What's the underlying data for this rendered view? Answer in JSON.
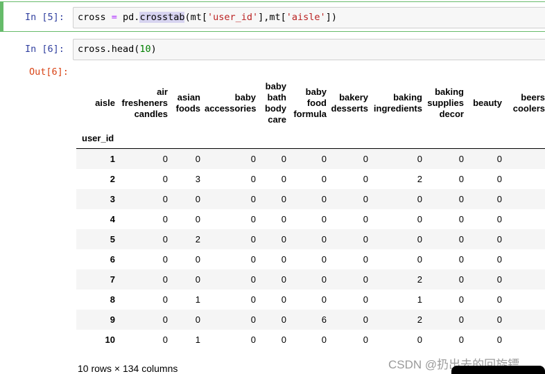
{
  "cells": [
    {
      "prompt": "In  [5]:",
      "code": {
        "a": "cross ",
        "op": "=",
        "b": " pd.",
        "hl": "crosstab",
        "c": "(mt[",
        "s1": "'user_id'",
        "d": "],mt[",
        "s2": "'aisle'",
        "e": "])"
      }
    },
    {
      "prompt": "In  [6]:",
      "code": {
        "a": "cross.head(",
        "n": "10",
        "e": ")"
      }
    }
  ],
  "output_prompt": "Out[6]:",
  "table": {
    "columns_label": "aisle",
    "index_label": "user_id",
    "columns": [
      "air fresheners candles",
      "asian foods",
      "baby accessories",
      "baby bath body care",
      "baby food formula",
      "bakery desserts",
      "baking ingredients",
      "baking supplies decor",
      "beauty",
      "beers coolers"
    ],
    "rows": [
      {
        "id": "1",
        "v": [
          "0",
          "0",
          "0",
          "0",
          "0",
          "0",
          "0",
          "0",
          "0"
        ]
      },
      {
        "id": "2",
        "v": [
          "0",
          "3",
          "0",
          "0",
          "0",
          "0",
          "2",
          "0",
          "0"
        ]
      },
      {
        "id": "3",
        "v": [
          "0",
          "0",
          "0",
          "0",
          "0",
          "0",
          "0",
          "0",
          "0"
        ]
      },
      {
        "id": "4",
        "v": [
          "0",
          "0",
          "0",
          "0",
          "0",
          "0",
          "0",
          "0",
          "0"
        ]
      },
      {
        "id": "5",
        "v": [
          "0",
          "2",
          "0",
          "0",
          "0",
          "0",
          "0",
          "0",
          "0"
        ]
      },
      {
        "id": "6",
        "v": [
          "0",
          "0",
          "0",
          "0",
          "0",
          "0",
          "0",
          "0",
          "0"
        ]
      },
      {
        "id": "7",
        "v": [
          "0",
          "0",
          "0",
          "0",
          "0",
          "0",
          "2",
          "0",
          "0"
        ]
      },
      {
        "id": "8",
        "v": [
          "0",
          "1",
          "0",
          "0",
          "0",
          "0",
          "1",
          "0",
          "0"
        ]
      },
      {
        "id": "9",
        "v": [
          "0",
          "0",
          "0",
          "0",
          "6",
          "0",
          "2",
          "0",
          "0"
        ]
      },
      {
        "id": "10",
        "v": [
          "0",
          "1",
          "0",
          "0",
          "0",
          "0",
          "0",
          "0",
          "0"
        ]
      }
    ]
  },
  "footer": "10 rows × 134 columns",
  "watermark": "CSDN @扔出去的回旋镖"
}
